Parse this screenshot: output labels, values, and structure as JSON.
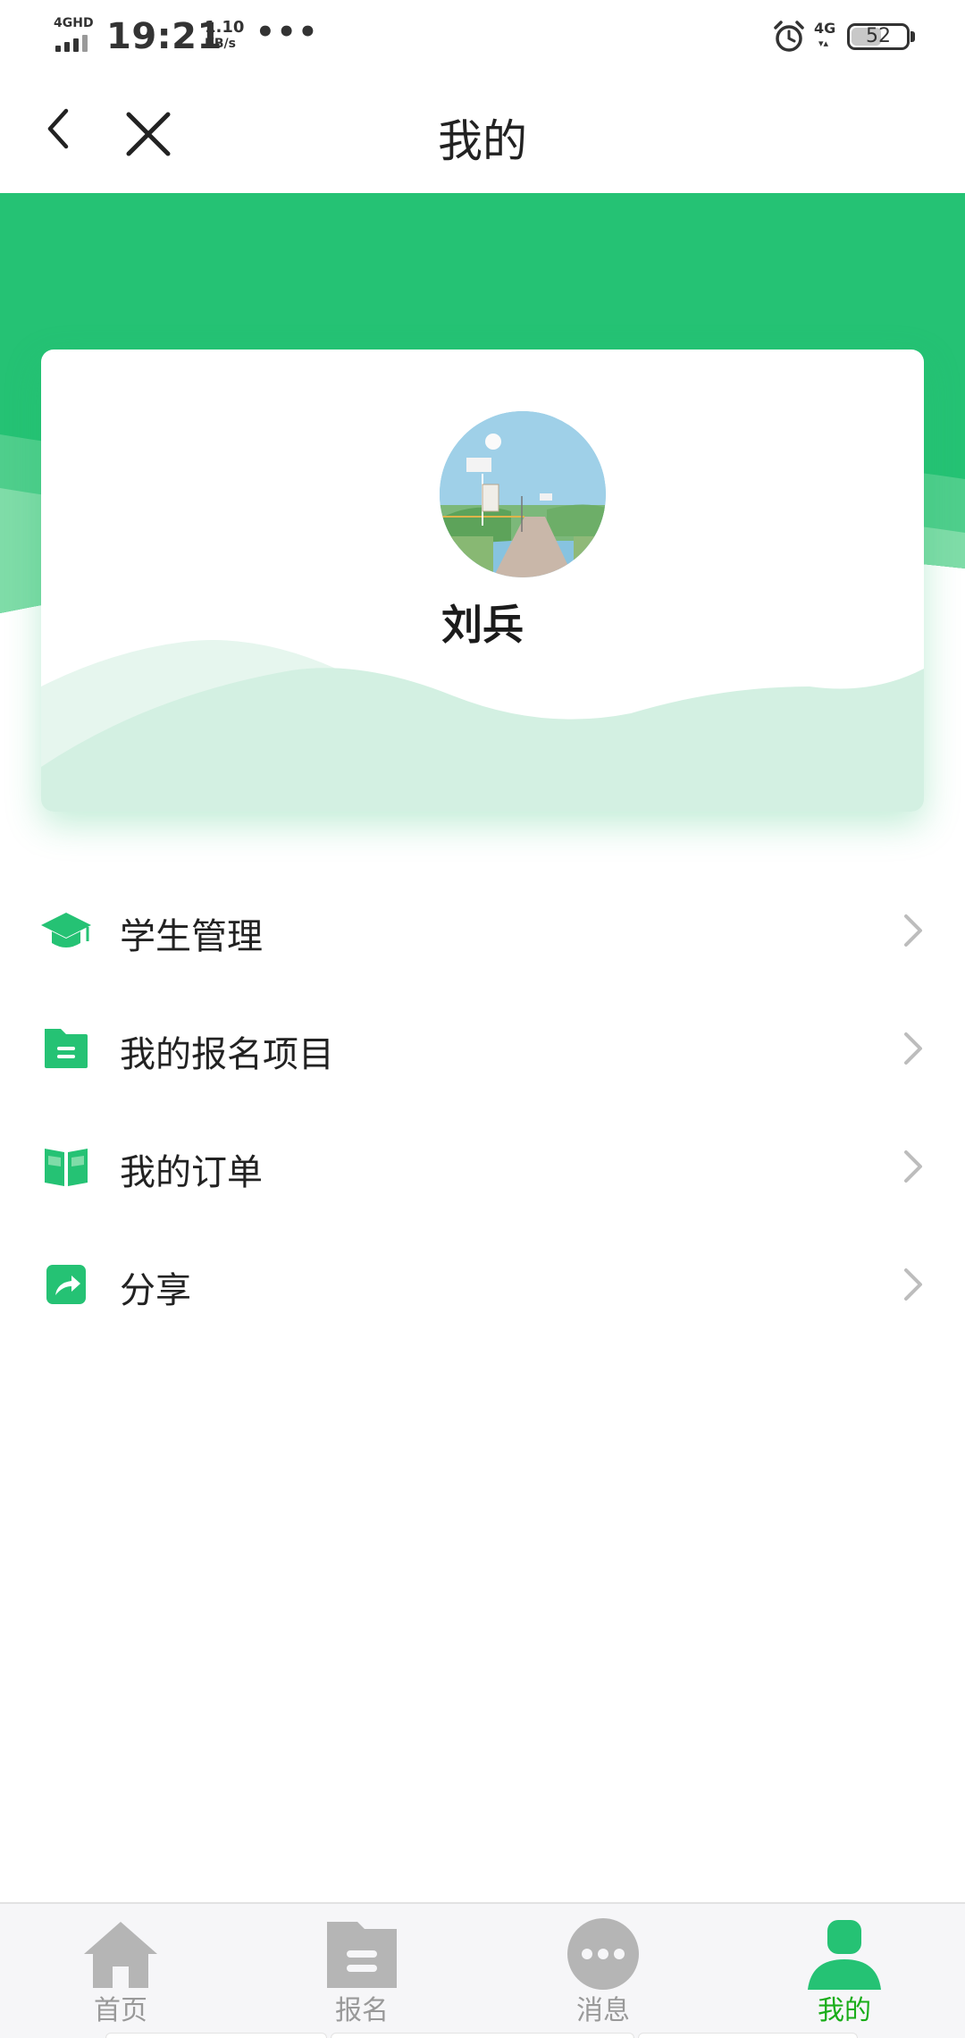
{
  "status_bar": {
    "network": "4GHD",
    "time": "19:21",
    "speed_value": "1.10",
    "speed_unit": "KB/s",
    "more": "•••",
    "network_right": "4G",
    "battery": "52"
  },
  "nav": {
    "title": "我的",
    "back_icon": "chevron-left-icon",
    "close_icon": "close-icon"
  },
  "profile": {
    "name": "刘兵",
    "avatar_icon": "landscape-photo"
  },
  "menu": {
    "items": [
      {
        "label": "学生管理",
        "icon": "graduation-cap-icon"
      },
      {
        "label": "我的报名项目",
        "icon": "document-icon"
      },
      {
        "label": "我的订单",
        "icon": "book-icon"
      },
      {
        "label": "分享",
        "icon": "share-icon"
      }
    ]
  },
  "tabbar": {
    "tabs": [
      {
        "label": "首页",
        "icon": "home-icon",
        "active": false
      },
      {
        "label": "报名",
        "icon": "clipboard-icon",
        "active": false
      },
      {
        "label": "消息",
        "icon": "chat-icon",
        "active": false
      },
      {
        "label": "我的",
        "icon": "user-icon",
        "active": true
      }
    ]
  },
  "colors": {
    "accent": "#25c274",
    "accent_light": "#7fdca8",
    "tab_active": "#1aad19",
    "tab_inactive": "#999999"
  }
}
